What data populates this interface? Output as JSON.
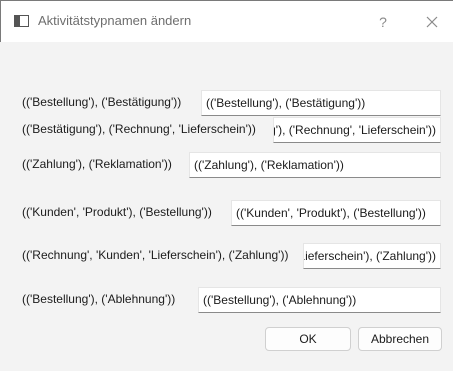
{
  "window": {
    "title": "Aktivitätstypnamen ändern",
    "help_label": "?",
    "close_label": "Close"
  },
  "rows": [
    {
      "label": "(('Bestellung'), ('Bestätigung'))",
      "value": "(('Bestellung'), ('Bestätigung'))"
    },
    {
      "label": "(('Bestätigung'), ('Rechnung', 'Lieferschein'))",
      "value": "(('Bestätigung'), ('Rechnung', 'Lieferschein'))"
    },
    {
      "label": "(('Zahlung'), ('Reklamation'))",
      "value": "(('Zahlung'), ('Reklamation'))"
    },
    {
      "label": "(('Kunden', 'Produkt'), ('Bestellung'))",
      "value": "(('Kunden', 'Produkt'), ('Bestellung'))"
    },
    {
      "label": "(('Rechnung', 'Kunden', 'Lieferschein'), ('Zahlung'))",
      "value": "(('Rechnung', 'Kunden', 'Lieferschein'), ('Zahlung'))"
    },
    {
      "label": "(('Bestellung'), ('Ablehnung'))",
      "value": "(('Bestellung'), ('Ablehnung'))"
    }
  ],
  "buttons": {
    "ok": "OK",
    "cancel": "Abbrechen"
  }
}
